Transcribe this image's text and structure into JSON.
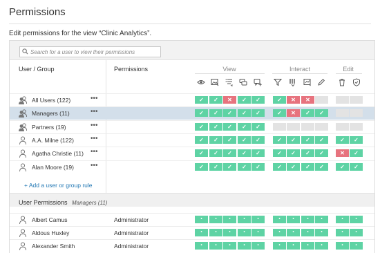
{
  "page": {
    "title": "Permissions",
    "subtitle": "Edit permissions for the view “Clinic Analytics”."
  },
  "search": {
    "placeholder": "Search for a user to view their permissions"
  },
  "table": {
    "col_user": "User / Group",
    "col_permissions": "Permissions",
    "capability_groups": [
      "View",
      "Interact",
      "Edit"
    ],
    "capability_icons": [
      "view-icon",
      "export-image-icon",
      "summary-data-icon",
      "comments-icon",
      "add-comment-icon",
      "filter-icon",
      "underlying-data-icon",
      "download-icon",
      "edit-pencil-icon",
      "delete-icon",
      "set-permissions-icon"
    ]
  },
  "rules": [
    {
      "name": "All Users (122)",
      "kind": "group",
      "selected": false,
      "perms": [
        "allow",
        "allow",
        "deny",
        "allow",
        "allow",
        "allow",
        "deny",
        "deny",
        "none",
        "none",
        "none"
      ]
    },
    {
      "name": "Managers (11)",
      "kind": "group",
      "selected": true,
      "perms": [
        "allow",
        "allow",
        "allow",
        "allow",
        "allow",
        "allow",
        "deny",
        "allow",
        "allow",
        "none",
        "none"
      ]
    },
    {
      "name": "Partners (19)",
      "kind": "group",
      "selected": false,
      "perms": [
        "allow",
        "allow",
        "allow",
        "allow",
        "allow",
        "none",
        "none",
        "none",
        "none",
        "none",
        "none"
      ]
    },
    {
      "name": "A.A. Milne (122)",
      "kind": "user",
      "selected": false,
      "perms": [
        "allow",
        "allow",
        "allow",
        "allow",
        "allow",
        "allow",
        "allow",
        "allow",
        "allow",
        "allow",
        "allow"
      ]
    },
    {
      "name": "Agatha Christie (11)",
      "kind": "user",
      "selected": false,
      "perms": [
        "allow",
        "allow",
        "allow",
        "allow",
        "allow",
        "allow",
        "allow",
        "allow",
        "allow",
        "deny",
        "allow"
      ]
    },
    {
      "name": "Alan Moore (19)",
      "kind": "user",
      "selected": false,
      "perms": [
        "allow",
        "allow",
        "allow",
        "allow",
        "allow",
        "allow",
        "allow",
        "allow",
        "allow",
        "allow",
        "allow"
      ]
    }
  ],
  "add_rule_label": "+ Add a user or group rule",
  "user_permissions": {
    "title": "User Permissions",
    "group": "Managers (11)",
    "rows": [
      {
        "name": "Albert Camus",
        "role": "Administrator"
      },
      {
        "name": "Aldous Huxley",
        "role": "Administrator"
      },
      {
        "name": "Alexander Smith",
        "role": "Administrator"
      }
    ]
  },
  "more_label": "•••",
  "symbols": {
    "allow": "✓",
    "deny": "✕",
    "none": "",
    "effective": "•"
  },
  "colors": {
    "allow": "#5ed3a4",
    "deny": "#e7737e",
    "none": "#e3e3e3",
    "selected_row": "#d3dfea",
    "link": "#1f76b3"
  }
}
